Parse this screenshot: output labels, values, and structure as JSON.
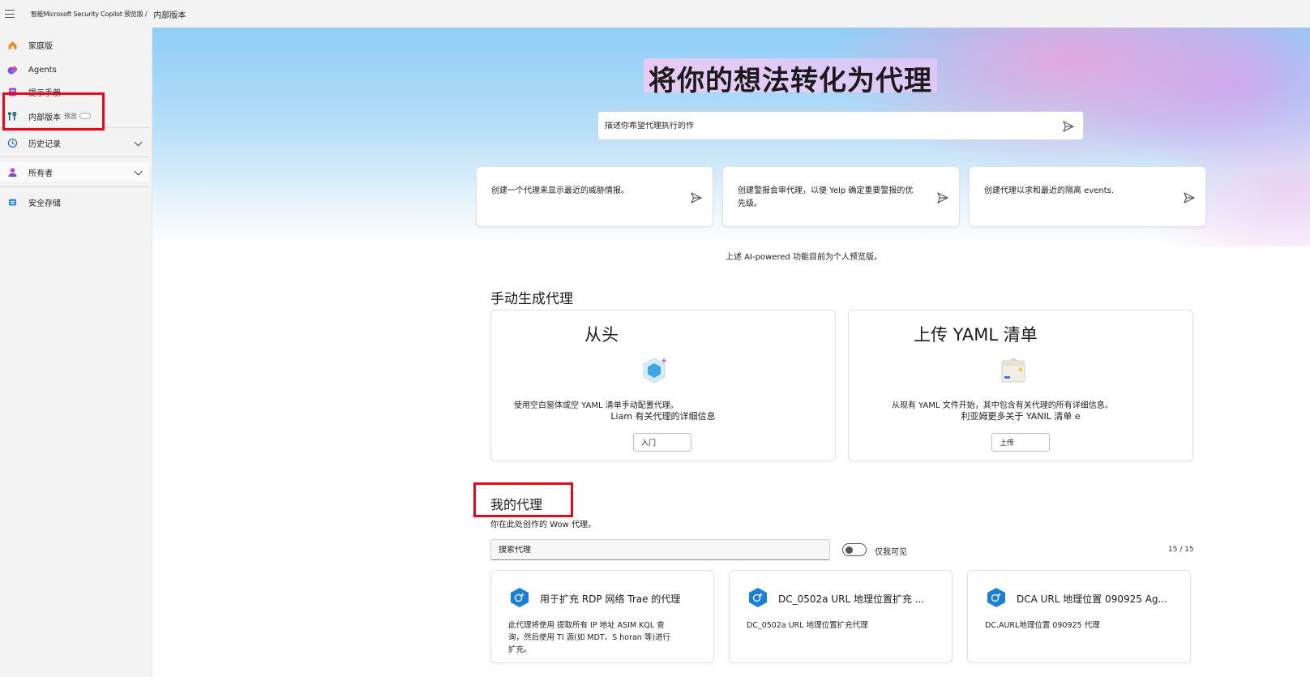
{
  "topbar": {
    "brand": "智能Microsoft Security Copilot 预览版 /",
    "crumb": "内部版本"
  },
  "sidebar": {
    "items": [
      {
        "label": "家庭版",
        "icon": "home-icon"
      },
      {
        "label": "Agents",
        "icon": "agents-icon"
      },
      {
        "label": "提示手册",
        "icon": "promptbook-icon"
      },
      {
        "label": "内部版本",
        "badge": "预览",
        "icon": "build-icon"
      },
      {
        "label": "历史记录",
        "icon": "history-icon"
      },
      {
        "label": "所有者",
        "icon": "owner-icon"
      },
      {
        "label": "安全存储",
        "icon": "storage-icon"
      }
    ]
  },
  "hero": {
    "title": "将你的想法转化为代理",
    "prompt_placeholder": "描述你希望代理执行的作"
  },
  "suggestions": [
    {
      "text": "创建一个代理来显示最近的威胁情报。"
    },
    {
      "text": "创建警报会审代理，以便 Yelp 确定重要警报的优先级。"
    },
    {
      "text": "创建代理以求和最近的隔离 events."
    }
  ],
  "ai_note": "上述 AI-powered 功能目前为个人预览版。",
  "manual": {
    "heading": "手动生成代理",
    "scratch": {
      "title": "从头",
      "desc": "使用空白窗体或空 YAML 清单手动配置代理。",
      "more": "Liam 有关代理的详细信息",
      "button": "入门"
    },
    "upload": {
      "title": "上传 YAML 清单",
      "desc": "从现有 YAML 文件开始，其中包含有关代理的所有详细信息。",
      "more": "利亚姆更多关于 YANIL 清单 e",
      "button": "上传"
    }
  },
  "my_agents": {
    "heading": "我的代理",
    "subtitle": "你在此处创作的 Wow 代理。",
    "search_placeholder": "搜索代理",
    "toggle_label": "仅我可见",
    "count": "15 / 15",
    "cards": [
      {
        "name": "用于扩充 RDP 网络 Trae 的代理",
        "desc": "此代理将使用 提取所有 IP 地址 ASIM KQL 查询，然后使用 TI 源(如 MDT、S horan 等)进行扩充。"
      },
      {
        "name": "DC_0502a URL 地理位置扩充 ...",
        "desc": "DC_0502a URL 地理位置扩充代理"
      },
      {
        "name": "DCA URL 地理位置 090925 Ag...",
        "desc": "DC.AURL地理位置 090925 代理"
      }
    ]
  },
  "colors": {
    "highlight": "#e00b1c",
    "agent_icon": "#1a7fd6"
  }
}
